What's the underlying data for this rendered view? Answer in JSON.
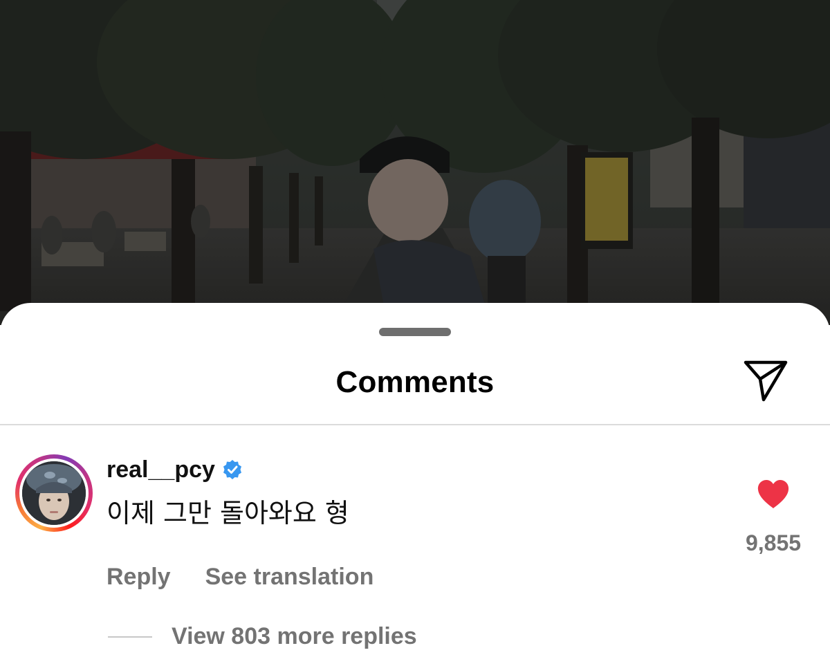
{
  "sheet": {
    "title": "Comments",
    "share_icon": "paper-plane-icon"
  },
  "comment": {
    "username": "real__pcy",
    "verified": true,
    "verified_icon": "verified-badge-icon",
    "text": "이제 그만 돌아와요 형",
    "reply_label": "Reply",
    "translation_label": "See translation",
    "like_icon": "heart-icon",
    "like_color": "#ed3346",
    "like_count": "9,855",
    "view_replies_label": "View 803 more replies"
  },
  "colors": {
    "verified": "#3897f0",
    "secondary_text": "#737373",
    "grabber": "#6e6e6e"
  }
}
